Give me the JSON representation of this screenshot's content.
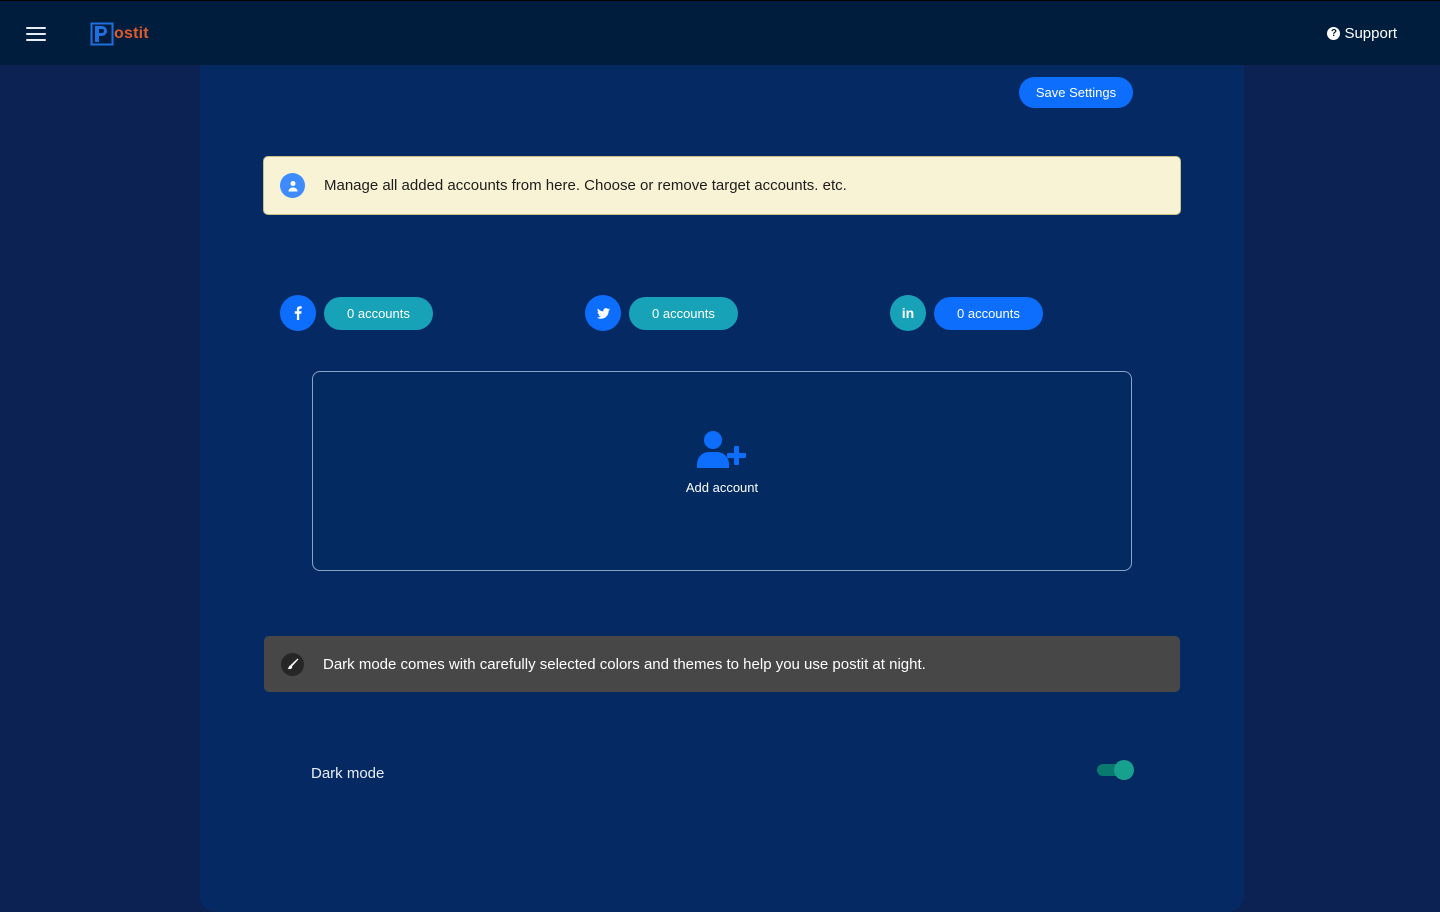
{
  "app": {
    "logo_text": "ostit",
    "support_label": "Support"
  },
  "toolbar": {
    "save_label": "Save Settings"
  },
  "accounts_notice": {
    "text": "Manage all added accounts from here. Choose or remove target accounts. etc."
  },
  "social_accounts": [
    {
      "network": "facebook",
      "icon": "facebook-icon",
      "count_label": "0 accounts",
      "circle_color": "#0d6efd",
      "pill_color": "#17a2b8"
    },
    {
      "network": "twitter",
      "icon": "twitter-icon",
      "count_label": "0 accounts",
      "circle_color": "#0d6efd",
      "pill_color": "#17a2b8"
    },
    {
      "network": "linkedin",
      "icon": "linkedin-icon",
      "count_label": "0 accounts",
      "circle_color": "#17a2b8",
      "pill_color": "#0d6efd"
    }
  ],
  "add_account": {
    "label": "Add account"
  },
  "dark_mode_notice": {
    "text": "Dark mode comes with carefully selected colors and themes to help you use postit at night."
  },
  "dark_mode_setting": {
    "label": "Dark mode",
    "enabled": true
  },
  "colors": {
    "navbar": "#001d3d",
    "panel": "#052a63",
    "primary": "#0d6efd",
    "info": "#17a2b8",
    "toggle_on": "#17a08e"
  }
}
